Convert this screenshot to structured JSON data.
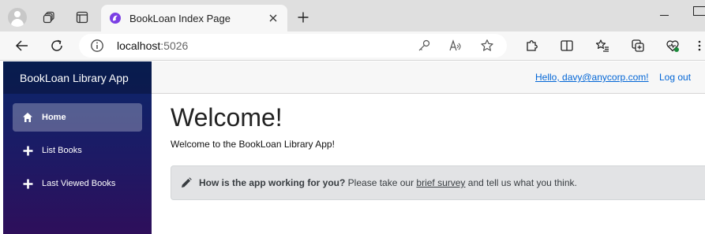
{
  "browser": {
    "tab_title": "BookLoan Index Page",
    "url_host": "localhost",
    "url_port": ":5026"
  },
  "app": {
    "brand": "BookLoan Library App",
    "nav": [
      {
        "label": "Home",
        "icon": "home-icon",
        "active": true
      },
      {
        "label": "List Books",
        "icon": "plus-icon",
        "active": false
      },
      {
        "label": "Last Viewed Books",
        "icon": "plus-icon",
        "active": false
      }
    ],
    "topbar": {
      "hello": "Hello, davy@anycorp.com!",
      "logout": "Log out"
    },
    "main": {
      "heading": "Welcome!",
      "lead": "Welcome to the BookLoan Library App!",
      "survey": {
        "question": "How is the app working for you?",
        "pre": " Please take our ",
        "link": "brief survey",
        "post": " and tell us what you think."
      }
    }
  },
  "colors": {
    "sidebar_top": "#0a2769",
    "sidebar_bottom": "#2e0f5b",
    "link": "#0366d6",
    "alert_bg": "#e2e3e5"
  }
}
